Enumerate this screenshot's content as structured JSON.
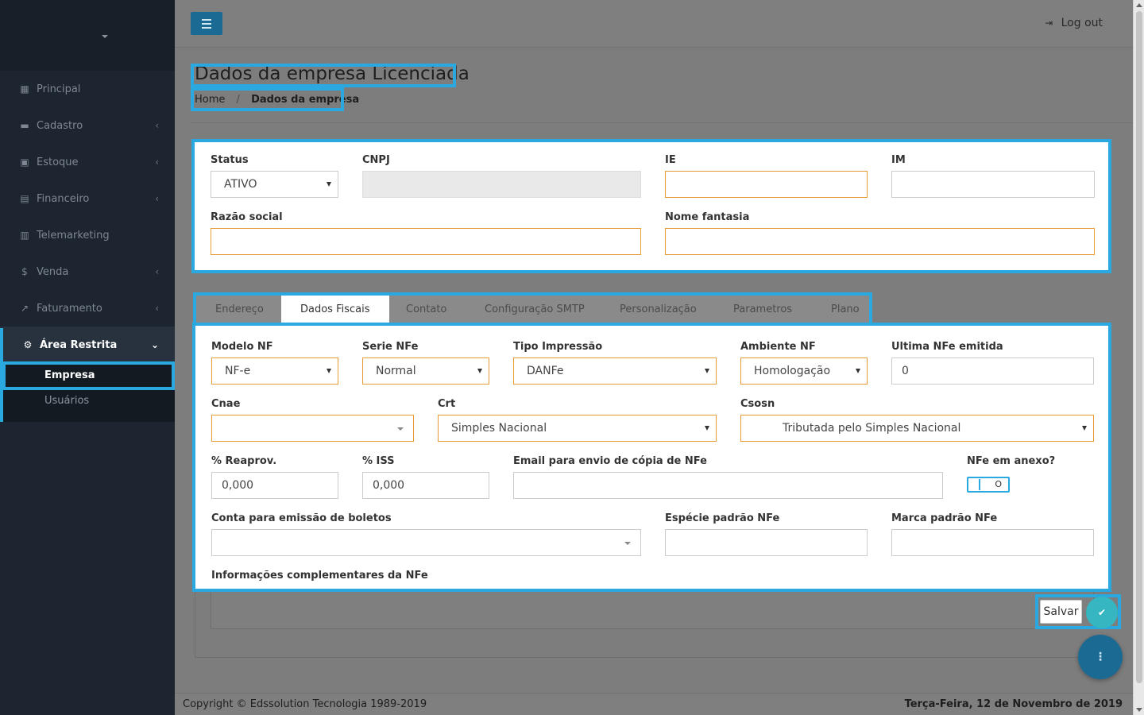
{
  "sidebar": {
    "items": [
      {
        "label": "Principal",
        "icon": "dashboard-icon"
      },
      {
        "label": "Cadastro",
        "icon": "address-card-icon"
      },
      {
        "label": "Estoque",
        "icon": "box-icon"
      },
      {
        "label": "Financeiro",
        "icon": "bank-icon"
      },
      {
        "label": "Telemarketing",
        "icon": "calendar-icon"
      },
      {
        "label": "Venda",
        "icon": "dollar-icon"
      },
      {
        "label": "Faturamento",
        "icon": "chart-line-icon"
      },
      {
        "label": "Área Restrita",
        "icon": "gears-icon"
      }
    ],
    "subitems": [
      {
        "label": "Empresa"
      },
      {
        "label": "Usuários"
      }
    ]
  },
  "header": {
    "logout_label": "Log out",
    "page_title": "Dados da empresa Licenciada",
    "breadcrumb_home": "Home",
    "breadcrumb_sep": "/",
    "breadcrumb_current": "Dados da empresa"
  },
  "company": {
    "status_label": "Status",
    "status_value": "ATIVO",
    "cnpj_label": "CNPJ",
    "cnpj_value": "",
    "ie_label": "IE",
    "ie_value": "",
    "im_label": "IM",
    "im_value": "",
    "razao_label": "Razão social",
    "razao_value": "",
    "fantasia_label": "Nome fantasia",
    "fantasia_value": ""
  },
  "tabs": [
    {
      "label": "Endereço"
    },
    {
      "label": "Dados Fiscais"
    },
    {
      "label": "Contato"
    },
    {
      "label": "Configuração SMTP"
    },
    {
      "label": "Personalização"
    },
    {
      "label": "Parametros"
    },
    {
      "label": "Plano"
    }
  ],
  "fiscal": {
    "modelo_label": "Modelo NF",
    "modelo_value": "NF-e",
    "serie_label": "Serie NFe",
    "serie_value": "Normal",
    "tipo_label": "Tipo Impressão",
    "tipo_value": "DANFe",
    "ambiente_label": "Ambiente NF",
    "ambiente_value": "Homologação",
    "ultima_label": "Ultima NFe emitida",
    "ultima_value": "0",
    "cnae_label": "Cnae",
    "cnae_value": "",
    "crt_label": "Crt",
    "crt_value": "Simples Nacional",
    "csosn_label": "Csosn",
    "csosn_value": "Tributada pelo Simples Nacional",
    "reaprov_label": "% Reaprov.",
    "reaprov_value": "0,000",
    "iss_label": "% ISS",
    "iss_value": "0,000",
    "email_label": "Email para envio de cópia de NFe",
    "email_value": "",
    "anexo_label": "NFe em anexo?",
    "anexo_toggle_text": "O",
    "conta_label": "Conta para emissão de boletos",
    "conta_value": "",
    "especie_label": "Espécie padrão NFe",
    "especie_value": "",
    "marca_label": "Marca padrão NFe",
    "marca_value": "",
    "info_label": "Informações complementares da NFe"
  },
  "actions": {
    "save_label": "Salvar"
  },
  "footer": {
    "copyright": "Copyright © Edssolution Tecnologia 1989-2019",
    "date": "Terça-Feira, 12 de Novembro de 2019"
  },
  "colors": {
    "accent": "#29a9e0",
    "primary_button": "#1b6a94",
    "warning_border": "#e89b33",
    "save_check": "#36b6c0"
  }
}
